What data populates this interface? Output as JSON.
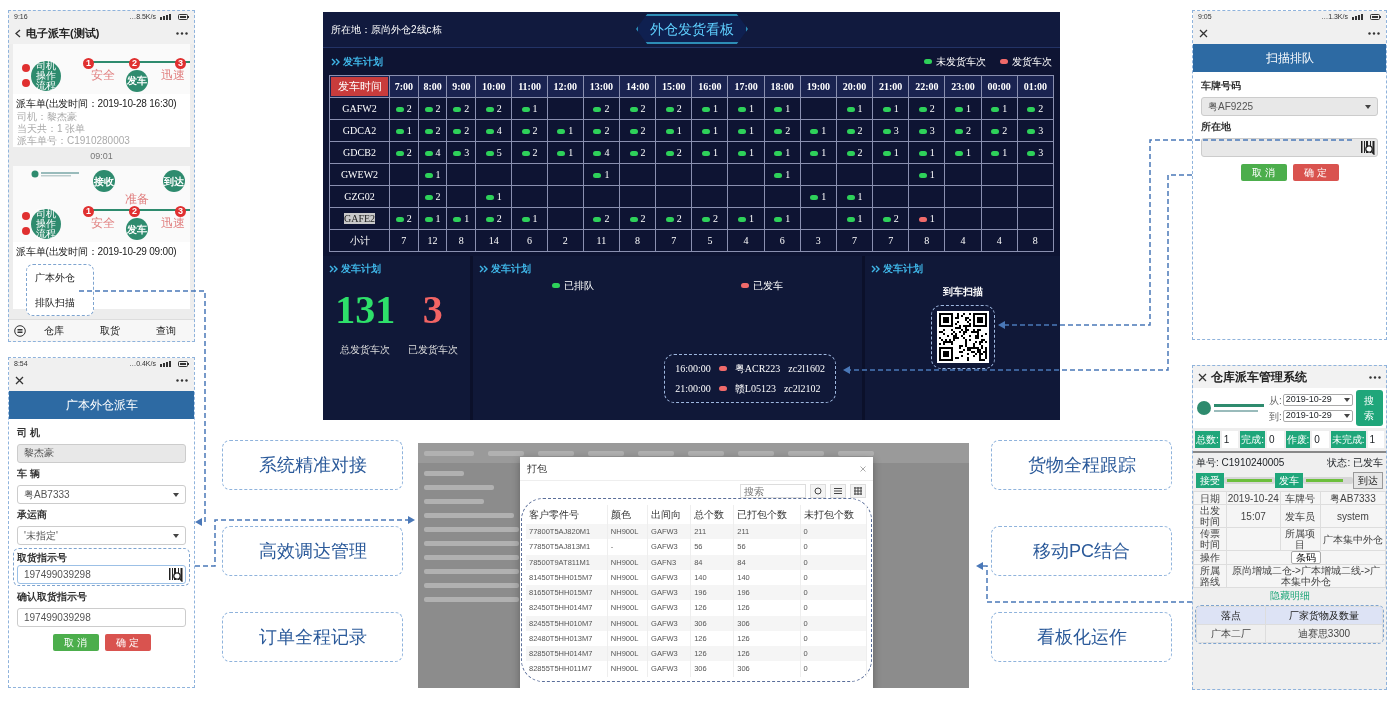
{
  "phone_dispatch": {
    "status_time": "9:16",
    "status_net": "…8.5K/s",
    "title": "电子派车(测试)",
    "cards": [
      {
        "illustration": {
          "bottom_step": "发车",
          "hub": "司机操作流程",
          "markers": [
            "1",
            "2",
            "3"
          ],
          "faded": [
            "安全",
            "迅速"
          ]
        },
        "title": "派车单(出发时间：2019-10-28 16:30)",
        "lines": [
          "司机：黎杰豪",
          "当天共：1 张单",
          "派车单号：C1910280003"
        ]
      },
      {
        "illustration": {
          "top_steps": [
            "接收",
            "到达"
          ],
          "bottom_step": "发车",
          "hub": "司机操作流程",
          "markers": [
            "1",
            "2",
            "3"
          ],
          "faded": [
            "安全",
            "准备",
            "迅速"
          ],
          "logo": true
        },
        "title": "派车单(出发时间：2019-10-29 09:00)"
      }
    ],
    "timestamp": "09:01",
    "popup_menu": [
      "广本外仓",
      "排队扫描"
    ],
    "tabbar": [
      "仓库",
      "取货",
      "查询"
    ]
  },
  "phone_form": {
    "status_time": "8:54",
    "status_net": "…0.4K/s",
    "header": "广本外仓派车",
    "fields": [
      {
        "label": "司 机",
        "kind": "readonly",
        "value": "黎杰豪"
      },
      {
        "label": "车 辆",
        "kind": "select",
        "value": "粤AB7333"
      },
      {
        "label": "承运商",
        "kind": "select",
        "value": "'未指定'"
      },
      {
        "label": "取货指示号",
        "kind": "scan",
        "value": "197499039298",
        "highlighted": true
      },
      {
        "label": "确认取货指示号",
        "kind": "input",
        "value": "197499039298"
      }
    ],
    "buttons": [
      {
        "label": "取 消",
        "kind": "cancel"
      },
      {
        "label": "确 定",
        "kind": "confirm"
      }
    ]
  },
  "board": {
    "location": "所在地：原尚外仓2线c栋",
    "title": "外仓发货看板",
    "section": "发车计划",
    "legend": [
      {
        "label": "未发货车次",
        "color": "#2ed15a"
      },
      {
        "label": "发货车次",
        "color": "#f06a6a"
      }
    ],
    "table": {
      "corner": "发车时间",
      "hours": [
        "7:00",
        "8:00",
        "9:00",
        "10:00",
        "11:00",
        "12:00",
        "13:00",
        "14:00",
        "15:00",
        "16:00",
        "17:00",
        "18:00",
        "19:00",
        "20:00",
        "21:00",
        "22:00",
        "23:00",
        "00:00",
        "01:00"
      ],
      "rows": [
        {
          "code": "GAFW2",
          "highlighted": false,
          "cells": [
            {
              "n": "2",
              "shipped": false
            },
            {
              "n": "2",
              "shipped": false
            },
            {
              "n": "2",
              "shipped": false
            },
            {
              "n": "2",
              "shipped": false
            },
            {
              "n": "1",
              "shipped": false
            },
            null,
            {
              "n": "2",
              "shipped": false
            },
            {
              "n": "2",
              "shipped": false
            },
            {
              "n": "2",
              "shipped": false
            },
            {
              "n": "1",
              "shipped": false
            },
            {
              "n": "1",
              "shipped": false
            },
            {
              "n": "1",
              "shipped": false
            },
            null,
            {
              "n": "1",
              "shipped": false
            },
            {
              "n": "1",
              "shipped": false
            },
            {
              "n": "2",
              "shipped": false
            },
            {
              "n": "1",
              "shipped": false
            },
            {
              "n": "1",
              "shipped": false
            },
            {
              "n": "2",
              "shipped": false
            }
          ]
        },
        {
          "code": "GDCA2",
          "highlighted": false,
          "cells": [
            {
              "n": "1",
              "shipped": false
            },
            {
              "n": "2",
              "shipped": false
            },
            {
              "n": "2",
              "shipped": false
            },
            {
              "n": "4",
              "shipped": false
            },
            {
              "n": "2",
              "shipped": false
            },
            {
              "n": "1",
              "shipped": false
            },
            {
              "n": "2",
              "shipped": false
            },
            {
              "n": "2",
              "shipped": false
            },
            {
              "n": "1",
              "shipped": false
            },
            {
              "n": "1",
              "shipped": false
            },
            {
              "n": "1",
              "shipped": false
            },
            {
              "n": "2",
              "shipped": false
            },
            {
              "n": "1",
              "shipped": false
            },
            {
              "n": "2",
              "shipped": false
            },
            {
              "n": "3",
              "shipped": false
            },
            {
              "n": "3",
              "shipped": false
            },
            {
              "n": "2",
              "shipped": false
            },
            {
              "n": "2",
              "shipped": false
            },
            {
              "n": "3",
              "shipped": false
            }
          ]
        },
        {
          "code": "GDCB2",
          "highlighted": false,
          "cells": [
            {
              "n": "2",
              "shipped": false
            },
            {
              "n": "4",
              "shipped": false
            },
            {
              "n": "3",
              "shipped": false
            },
            {
              "n": "5",
              "shipped": false
            },
            {
              "n": "2",
              "shipped": false
            },
            {
              "n": "1",
              "shipped": false
            },
            {
              "n": "4",
              "shipped": false
            },
            {
              "n": "2",
              "shipped": false
            },
            {
              "n": "2",
              "shipped": false
            },
            {
              "n": "1",
              "shipped": false
            },
            {
              "n": "1",
              "shipped": false
            },
            {
              "n": "1",
              "shipped": false
            },
            {
              "n": "1",
              "shipped": false
            },
            {
              "n": "2",
              "shipped": false
            },
            {
              "n": "1",
              "shipped": false
            },
            {
              "n": "1",
              "shipped": false
            },
            {
              "n": "1",
              "shipped": false
            },
            {
              "n": "1",
              "shipped": false
            },
            {
              "n": "3",
              "shipped": false
            }
          ]
        },
        {
          "code": "GWEW2",
          "highlighted": false,
          "cells": [
            null,
            {
              "n": "1",
              "shipped": false
            },
            null,
            null,
            null,
            null,
            {
              "n": "1",
              "shipped": false
            },
            null,
            null,
            null,
            null,
            {
              "n": "1",
              "shipped": false
            },
            null,
            null,
            null,
            {
              "n": "1",
              "shipped": false
            },
            null,
            null,
            null
          ]
        },
        {
          "code": "GZG02",
          "highlighted": false,
          "cells": [
            null,
            {
              "n": "2",
              "shipped": false
            },
            null,
            {
              "n": "1",
              "shipped": false
            },
            null,
            null,
            null,
            null,
            null,
            null,
            null,
            null,
            {
              "n": "1",
              "shipped": false
            },
            {
              "n": "1",
              "shipped": false
            },
            null,
            null,
            null,
            null,
            null
          ]
        },
        {
          "code": "GAFE2",
          "highlighted": true,
          "cells": [
            {
              "n": "2",
              "shipped": false
            },
            {
              "n": "1",
              "shipped": false
            },
            {
              "n": "1",
              "shipped": false
            },
            {
              "n": "2",
              "shipped": false
            },
            {
              "n": "1",
              "shipped": false
            },
            null,
            {
              "n": "2",
              "shipped": false
            },
            {
              "n": "2",
              "shipped": false
            },
            {
              "n": "2",
              "shipped": false
            },
            {
              "n": "2",
              "shipped": false
            },
            {
              "n": "1",
              "shipped": false
            },
            {
              "n": "1",
              "shipped": false
            },
            null,
            {
              "n": "1",
              "shipped": false
            },
            {
              "n": "2",
              "shipped": false
            },
            {
              "n": "1",
              "shipped": true
            },
            null,
            null,
            null
          ]
        }
      ],
      "total_label": "小计",
      "totals": [
        "7",
        "12",
        "8",
        "14",
        "6",
        "2",
        "11",
        "8",
        "7",
        "5",
        "4",
        "6",
        "3",
        "7",
        "7",
        "8",
        "4",
        "4",
        "8"
      ]
    },
    "stats_panel": {
      "section": "发车计划",
      "stats": [
        {
          "value": "131",
          "label": "总发货车次",
          "color": "#2ee06a"
        },
        {
          "value": "3",
          "label": "已发货车次",
          "color": "#f26464"
        }
      ]
    },
    "queue_panel": {
      "section": "发车计划",
      "legend": [
        {
          "label": "已排队",
          "color": "#2ed15a"
        },
        {
          "label": "已发车",
          "color": "#f06a6a"
        }
      ],
      "ticker": [
        {
          "time": "16:00:00",
          "color": "#f06a6a",
          "plate": "粤ACR223",
          "code": "zc2l1602"
        },
        {
          "time": "21:00:00",
          "color": "#f06a6a",
          "plate": "赣L05123",
          "code": "zc2l2102"
        }
      ]
    },
    "scan_panel": {
      "section": "发车计划",
      "label": "到车扫描"
    }
  },
  "features_left": [
    "系统精准对接",
    "高效调达管理",
    "订单全程记录"
  ],
  "features_right": [
    "货物全程跟踪",
    "移动PC结合",
    "看板化运作"
  ],
  "pack_dialog": {
    "title": "打包",
    "search_placeholder": "搜索",
    "columns": [
      "客户零件号",
      "颜色",
      "出间向",
      "总个数",
      "已打包个数",
      "未打包个数"
    ],
    "rows": [
      [
        "77800T5AJ820M1",
        "NH900L",
        "GAFW3",
        "211",
        "211",
        "0"
      ],
      [
        "77850T5AJ813M1",
        "-",
        "GAFW3",
        "56",
        "56",
        "0"
      ],
      [
        "78500T9AT811M1",
        "NH900L",
        "GAFN3",
        "84",
        "84",
        "0"
      ],
      [
        "81450T5HH015M7",
        "NH900L",
        "GAFW3",
        "140",
        "140",
        "0"
      ],
      [
        "81650T5HH015M7",
        "NH900L",
        "GAFW3",
        "196",
        "196",
        "0"
      ],
      [
        "82450T5HH014M7",
        "NH900L",
        "GAFW3",
        "126",
        "126",
        "0"
      ],
      [
        "82455T5HH010M7",
        "NH900L",
        "GAFW3",
        "306",
        "306",
        "0"
      ],
      [
        "82480T5HH013M7",
        "NH900L",
        "GAFW3",
        "126",
        "126",
        "0"
      ],
      [
        "82850T5HH014M7",
        "NH900L",
        "GAFW3",
        "126",
        "126",
        "0"
      ],
      [
        "82855T5HH011M7",
        "NH900L",
        "GAFW3",
        "306",
        "306",
        "0"
      ]
    ]
  },
  "phone_scan": {
    "status_time": "9:05",
    "status_net": "…1.3K/s",
    "header": "扫描排队",
    "fields": [
      {
        "label": "车牌号码",
        "kind": "select",
        "value": "粤AF9225"
      },
      {
        "label": "所在地",
        "kind": "scan"
      }
    ],
    "buttons": [
      {
        "label": "取 消",
        "kind": "cancel"
      },
      {
        "label": "确 定",
        "kind": "confirm"
      }
    ]
  },
  "phone_manage": {
    "title": "仓库派车管理系统",
    "from_label": "从:",
    "from": "2019-10-29",
    "to_label": "到:",
    "to": "2019-10-29",
    "search": "搜索",
    "stats": [
      {
        "label": "总数:",
        "value": "1"
      },
      {
        "label": "完成:",
        "value": "0"
      },
      {
        "label": "作废:",
        "value": "0"
      },
      {
        "label": "未完成:",
        "value": "1"
      }
    ],
    "order_label": "单号: C1910240005",
    "status_label": "状态: 已发车",
    "progress": [
      {
        "label": "接受",
        "kind": "done"
      },
      {
        "label": "发车",
        "kind": "done"
      },
      {
        "label": "到达",
        "kind": "pending"
      }
    ],
    "progress_bars": [
      {
        "level": 1
      },
      {
        "level": 0.85
      }
    ],
    "details": [
      {
        "label": "日期",
        "value": "2019-10-24"
      },
      {
        "label": "车牌号",
        "value": "粤AB7333"
      },
      {
        "label": "出发时间",
        "value": "15:07"
      },
      {
        "label": "发车员",
        "value": "system"
      },
      {
        "label": "传票时间"
      },
      {
        "label": "所属项目",
        "value": "广本集中外仓"
      }
    ],
    "operation": {
      "label": "操作",
      "button": "条码"
    },
    "route": {
      "label": "所属路线",
      "value": "原尚增城二仓->广本增城二线->广本集中外仓"
    },
    "toggle": "隐藏明细",
    "sub_columns": [
      "落点",
      "厂家货物及数量"
    ],
    "sub_rows": [
      [
        "广本二厂",
        "迪赛思3300"
      ]
    ]
  }
}
